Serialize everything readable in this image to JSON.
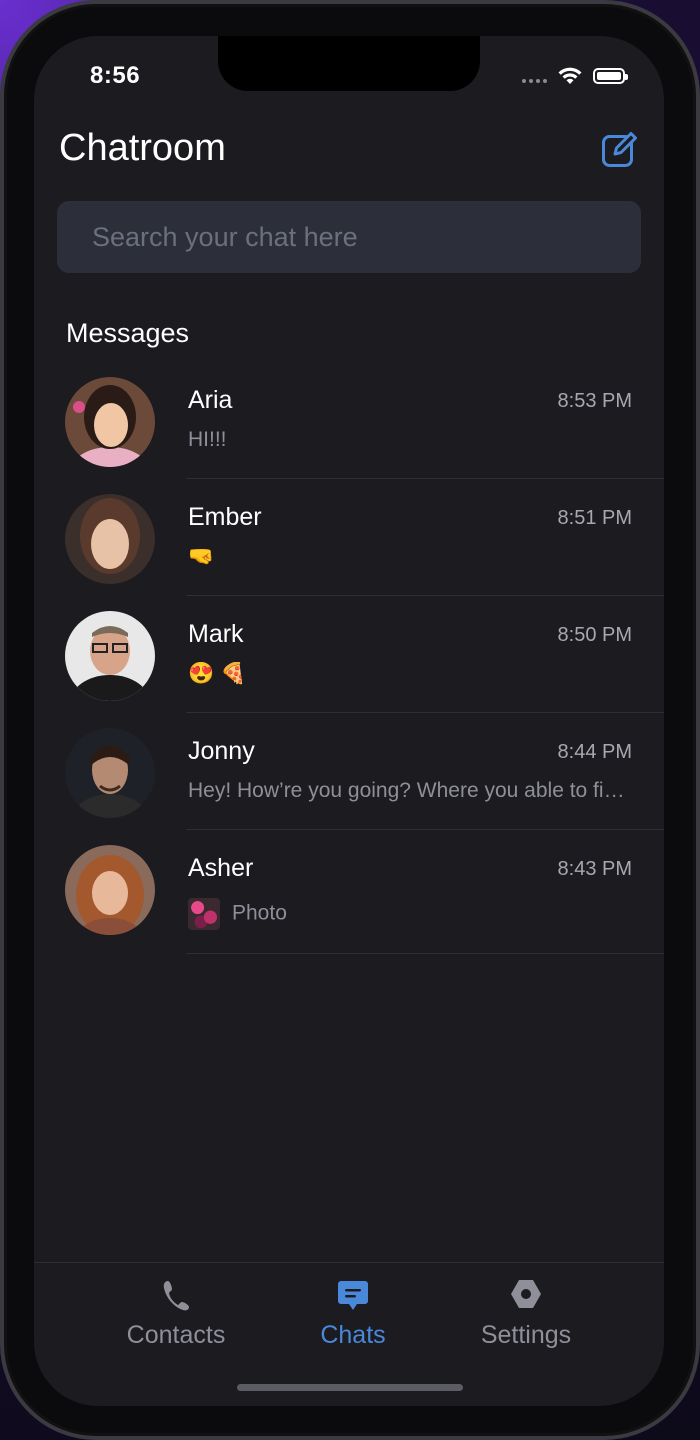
{
  "status": {
    "time": "8:56"
  },
  "header": {
    "title": "Chatroom",
    "compose_icon": "compose-icon"
  },
  "search": {
    "placeholder": "Search your chat here"
  },
  "section": {
    "label": "Messages"
  },
  "chats": [
    {
      "name": "Aria",
      "time": "8:53 PM",
      "preview": "HI!!!"
    },
    {
      "name": "Ember",
      "time": "8:51 PM",
      "preview": "🤜"
    },
    {
      "name": "Mark",
      "time": "8:50 PM",
      "preview": "😍 🍕"
    },
    {
      "name": "Jonny",
      "time": "8:44 PM",
      "preview": "Hey! How’re you going? Where you able to finish the project?"
    },
    {
      "name": "Asher",
      "time": "8:43 PM",
      "preview": "Photo"
    }
  ],
  "tabs": [
    {
      "label": "Contacts",
      "icon": "phone-icon"
    },
    {
      "label": "Chats",
      "icon": "chat-bubble-icon"
    },
    {
      "label": "Settings",
      "icon": "gear-icon"
    }
  ],
  "colors": {
    "accent": "#4a88d9",
    "background": "#1b1b20",
    "search_bg": "#2c2e3a"
  }
}
